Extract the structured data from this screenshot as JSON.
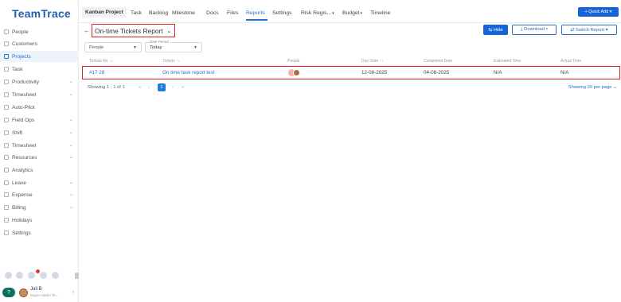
{
  "app": {
    "logo": "TeamTrace"
  },
  "sidebar": {
    "items": [
      {
        "label": "People",
        "chev": ""
      },
      {
        "label": "Customers",
        "chev": ""
      },
      {
        "label": "Projects",
        "chev": ""
      },
      {
        "label": "Task",
        "chev": ""
      },
      {
        "label": "Productivity",
        "chev": "⌄"
      },
      {
        "label": "Timesheet",
        "chev": "⌄"
      },
      {
        "label": "Auto-Pilot",
        "chev": ""
      },
      {
        "label": "Field Ops",
        "chev": "⌄"
      },
      {
        "label": "Shift",
        "chev": "⌄"
      },
      {
        "label": "Timesheet",
        "chev": "⌄"
      },
      {
        "label": "Resources",
        "chev": "⌄"
      },
      {
        "label": "Analytics",
        "chev": ""
      },
      {
        "label": "Leave",
        "chev": "⌄"
      },
      {
        "label": "Expense",
        "chev": "⌄"
      },
      {
        "label": "Billing",
        "chev": "⌄"
      },
      {
        "label": "Holidays",
        "chev": ""
      },
      {
        "label": "Settings",
        "chev": ""
      }
    ],
    "active_index": 2,
    "user": {
      "name": "Juli B",
      "role": "Super Admin Te...",
      "help": "?"
    }
  },
  "topnav": {
    "kanban": "Kanban Project",
    "tabs": [
      "Task",
      "Backlog",
      "Milestone",
      "Docs",
      "Files",
      "Reports",
      "Settings",
      "Risk Regis...",
      "Budget",
      "Timeline"
    ],
    "tab_carets": [
      "",
      "",
      "",
      "",
      "",
      "",
      "",
      "▾",
      "▾",
      ""
    ],
    "active_tab": "Reports",
    "quick_add": "+ Quick Add ▾"
  },
  "report": {
    "back": "←",
    "title": "On-time Tickets Report",
    "title_chevron": "⌄",
    "hide_label": "⇆ Hide",
    "download_label": "⤓ Download ▾",
    "switch_label": "⇄ Switch Report ▾"
  },
  "filters": {
    "people_placeholder": "People",
    "date_period_label": "Date Period",
    "date_period_value": "Today",
    "caret": "▼"
  },
  "table": {
    "headers": [
      "Tickets No ↑↓",
      "Tickets ↑↓",
      "People",
      "Due Date ↑↓",
      "Completed Date",
      "Estimated Time",
      "Actual Time"
    ],
    "rows": [
      {
        "ticket_no": "#17 28",
        "ticket": "On time task report test",
        "due_date": "12-08-2025",
        "completed_date": "04-08-2025",
        "estimated_time": "N/A",
        "actual_time": "N/A"
      }
    ]
  },
  "pagination": {
    "showing": "Showing 1 - 1 of 1",
    "first": "«",
    "prev": "‹",
    "current": "1",
    "next": "›",
    "last": "»",
    "per_page": "Showing 20 per page ⌄"
  }
}
